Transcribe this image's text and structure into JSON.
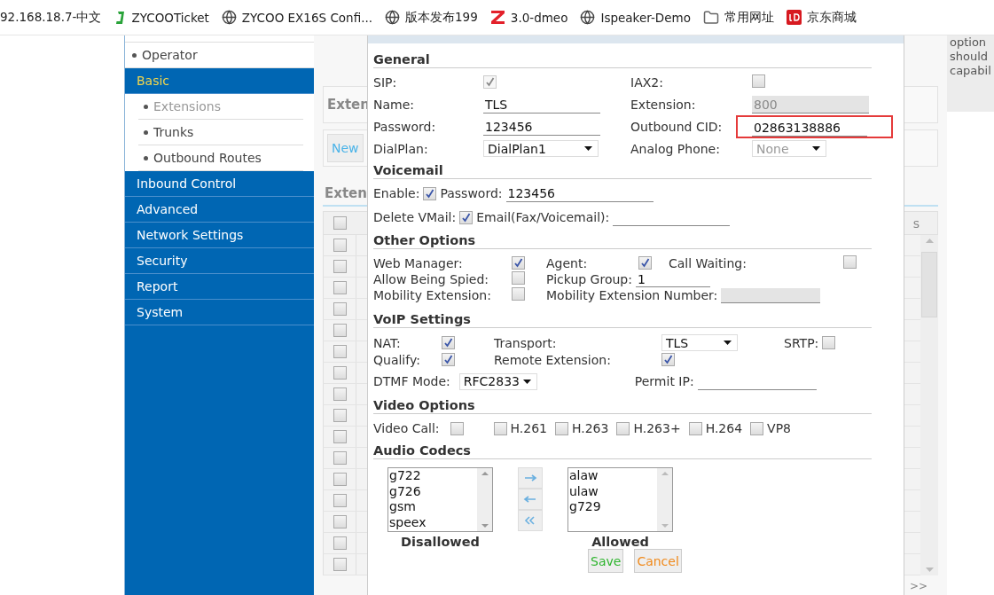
{
  "bookmarks": [
    {
      "label": "92.168.18.7-中文",
      "kind": "text"
    },
    {
      "label": "ZYCOOTicket",
      "kind": "ticket"
    },
    {
      "label": "ZYCOO EX16S Confi...",
      "kind": "globe"
    },
    {
      "label": "版本发布199",
      "kind": "globe"
    },
    {
      "label": "3.0-dmeo",
      "kind": "z"
    },
    {
      "label": "Ispeaker-Demo",
      "kind": "globe"
    },
    {
      "label": "常用网址",
      "kind": "folder"
    },
    {
      "label": "京东商城",
      "kind": "jd"
    }
  ],
  "sidebar": {
    "items": [
      {
        "label": "Operator",
        "kind": "sub",
        "selected": false
      },
      {
        "label": "Basic",
        "kind": "group",
        "selected": true,
        "expanded": true,
        "children": [
          {
            "label": "Extensions",
            "selected": true
          },
          {
            "label": "Trunks",
            "selected": false
          },
          {
            "label": "Outbound Routes",
            "selected": false
          }
        ]
      },
      {
        "label": "Inbound Control",
        "kind": "group",
        "selected": false
      },
      {
        "label": "Advanced",
        "kind": "group",
        "selected": false
      },
      {
        "label": "Network Settings",
        "kind": "group",
        "selected": false
      },
      {
        "label": "Security",
        "kind": "group",
        "selected": false
      },
      {
        "label": "Report",
        "kind": "group",
        "selected": false
      },
      {
        "label": "System",
        "kind": "group",
        "selected": false
      }
    ]
  },
  "background": {
    "title": "Exten",
    "new_button": "New",
    "tab": "Exten",
    "table": {
      "header_checked": false,
      "last_header": "s",
      "rows": [
        {
          "checked": false
        },
        {
          "checked": false
        },
        {
          "checked": false
        },
        {
          "checked": false
        },
        {
          "checked": false
        },
        {
          "checked": false
        },
        {
          "checked": false
        },
        {
          "checked": false
        },
        {
          "checked": false
        },
        {
          "checked": false
        },
        {
          "checked": false
        },
        {
          "checked": false
        },
        {
          "checked": false
        },
        {
          "checked": false
        },
        {
          "checked": false
        },
        {
          "checked": false
        }
      ]
    },
    "pager": ">>"
  },
  "side_note": {
    "lines": [
      "option",
      "should",
      "capabil"
    ]
  },
  "dialog": {
    "general": {
      "title": "General",
      "sip": {
        "label": "SIP:",
        "checked": true,
        "disabled": true
      },
      "iax2": {
        "label": "IAX2:",
        "checked": false,
        "disabled": false
      },
      "name": {
        "label": "Name:",
        "value": "TLS"
      },
      "extension": {
        "label": "Extension:",
        "value": "800",
        "disabled": true
      },
      "password": {
        "label": "Password:",
        "value": "123456"
      },
      "outbound_cid": {
        "label": "Outbound CID:",
        "value": "02863138886",
        "highlighted": true
      },
      "dialplan": {
        "label": "DialPlan:",
        "value": "DialPlan1",
        "disabled": false
      },
      "analog_phone": {
        "label": "Analog Phone:",
        "value": "None",
        "disabled": true
      }
    },
    "voicemail": {
      "title": "Voicemail",
      "enable": {
        "label": "Enable:",
        "checked": true
      },
      "password": {
        "label": "Password:",
        "value": "123456"
      },
      "delete_vmail": {
        "label": "Delete VMail:",
        "checked": true
      },
      "email": {
        "label": "Email(Fax/Voicemail):"
      }
    },
    "other_options": {
      "title": "Other Options",
      "web_manager": {
        "label": "Web Manager:",
        "checked": true
      },
      "agent": {
        "label": "Agent:",
        "checked": true
      },
      "call_waiting": {
        "label": "Call Waiting:",
        "checked": false
      },
      "allow_being_spied": {
        "label": "Allow Being Spied:",
        "checked": false
      },
      "pickup_group": {
        "label": "Pickup Group:",
        "value": "1"
      },
      "mobility_extension": {
        "label": "Mobility Extension:",
        "checked": false
      },
      "mobility_extension_number": {
        "label": "Mobility Extension Number:",
        "disabled": true
      }
    },
    "voip": {
      "title": "VoIP Settings",
      "nat": {
        "label": "NAT:",
        "checked": true
      },
      "transport": {
        "label": "Transport:",
        "value": "TLS"
      },
      "srtp": {
        "label": "SRTP:",
        "checked": false
      },
      "qualify": {
        "label": "Qualify:",
        "checked": true
      },
      "remote_extension": {
        "label": "Remote Extension:",
        "checked": true
      },
      "dtmf_mode": {
        "label": "DTMF Mode:",
        "value": "RFC2833"
      },
      "permit_ip": {
        "label": "Permit IP:"
      }
    },
    "video": {
      "title": "Video Options",
      "video_call": {
        "label": "Video Call:",
        "checked": false
      },
      "codecs": [
        {
          "label": "H.261",
          "checked": false
        },
        {
          "label": "H.263",
          "checked": false
        },
        {
          "label": "H.263+",
          "checked": false
        },
        {
          "label": "H.264",
          "checked": false
        },
        {
          "label": "VP8",
          "checked": false
        }
      ]
    },
    "audio": {
      "title": "Audio Codecs",
      "disallowed": {
        "title": "Disallowed",
        "items": [
          "g722",
          "g726",
          "gsm",
          "speex"
        ]
      },
      "allowed": {
        "title": "Allowed",
        "items": [
          "alaw",
          "ulaw",
          "g729"
        ]
      }
    },
    "buttons": [
      {
        "label": "Save",
        "kind": "save"
      },
      {
        "label": "Cancel",
        "kind": "cancel"
      }
    ]
  }
}
